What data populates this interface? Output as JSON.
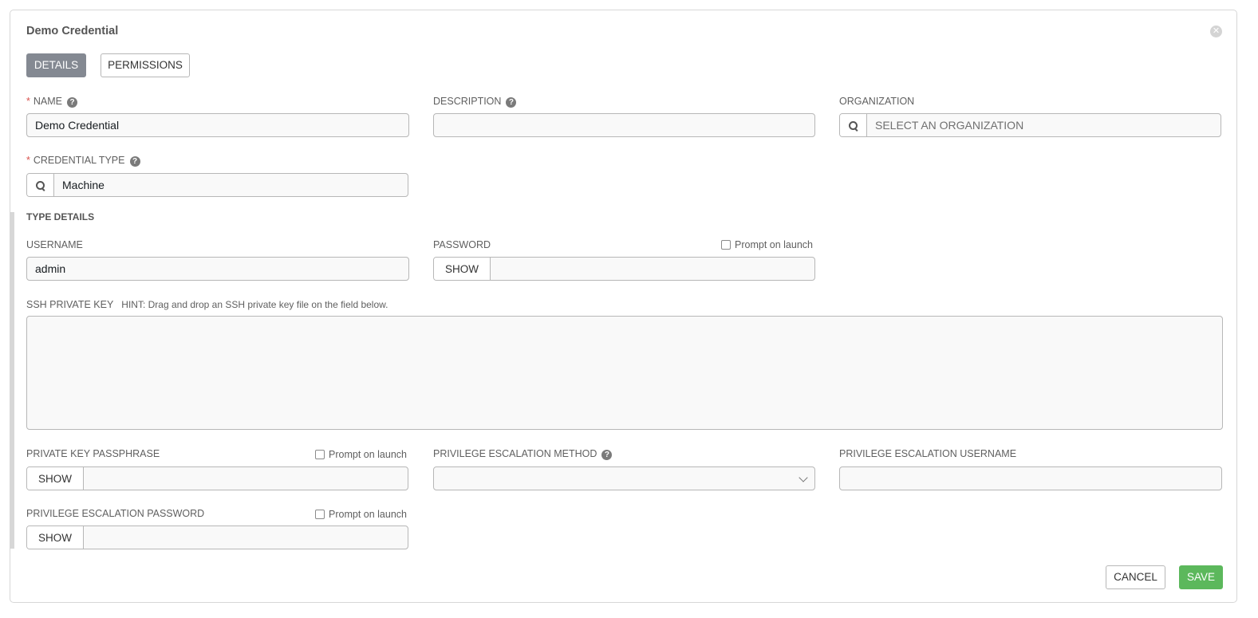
{
  "window": {
    "title": "Demo Credential",
    "close_icon": "close-icon"
  },
  "tabs": [
    {
      "label": "DETAILS",
      "active": true
    },
    {
      "label": "PERMISSIONS",
      "active": false
    }
  ],
  "form": {
    "name": {
      "label": "NAME",
      "required": "*",
      "value": "Demo Credential"
    },
    "description": {
      "label": "DESCRIPTION",
      "value": ""
    },
    "organization": {
      "label": "ORGANIZATION",
      "placeholder": "SELECT AN ORGANIZATION"
    },
    "credential_type": {
      "label": "CREDENTIAL TYPE",
      "required": "*",
      "value": "Machine"
    }
  },
  "type_details": {
    "title": "TYPE DETAILS",
    "username": {
      "label": "USERNAME",
      "value": "admin"
    },
    "password": {
      "label": "PASSWORD",
      "show_label": "SHOW",
      "prompt_label": "Prompt on launch",
      "prompt_checked": false
    },
    "ssh_private_key": {
      "label": "SSH PRIVATE KEY",
      "hint": "HINT: Drag and drop an SSH private key file on the field below.",
      "value": ""
    },
    "private_key_passphrase": {
      "label": "PRIVATE KEY PASSPHRASE",
      "show_label": "SHOW",
      "prompt_label": "Prompt on launch",
      "prompt_checked": false
    },
    "privilege_escalation_method": {
      "label": "PRIVILEGE ESCALATION METHOD",
      "value": ""
    },
    "privilege_escalation_username": {
      "label": "PRIVILEGE ESCALATION USERNAME",
      "value": ""
    },
    "privilege_escalation_password": {
      "label": "PRIVILEGE ESCALATION PASSWORD",
      "show_label": "SHOW",
      "prompt_label": "Prompt on launch",
      "prompt_checked": false
    }
  },
  "actions": {
    "cancel_label": "CANCEL",
    "save_label": "SAVE"
  },
  "colors": {
    "accent_tab": "#848992",
    "save_button": "#5cb85c",
    "required": "#d9534f"
  }
}
